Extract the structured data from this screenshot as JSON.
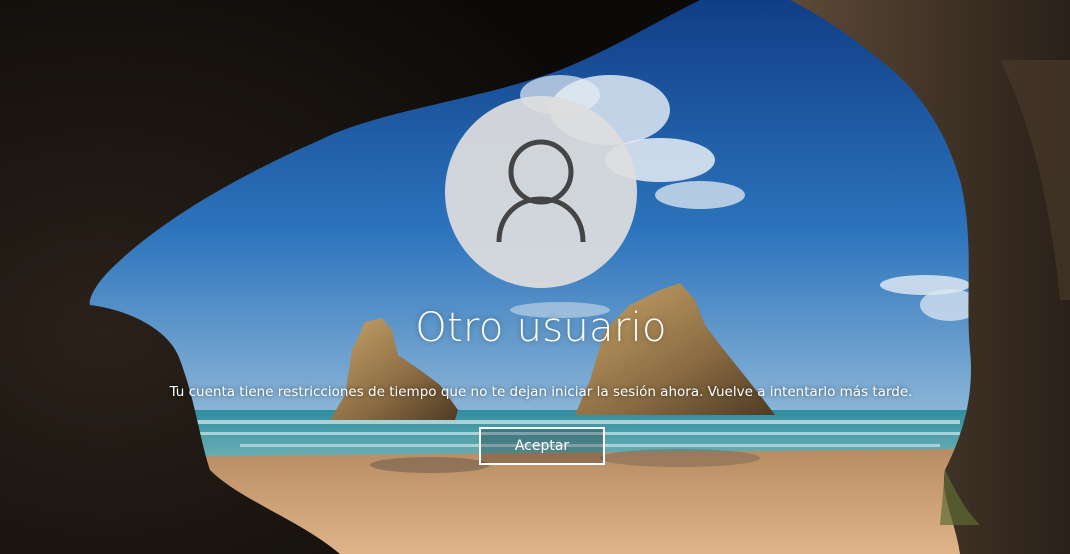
{
  "lockscreen": {
    "user_icon": "user-silhouette-icon",
    "username": "Otro usuario",
    "message": "Tu cuenta tiene restricciones de tiempo que no te dejan iniciar la sesión ahora. Vuelve a intentarlo más tarde.",
    "accept_label": "Aceptar"
  },
  "colors": {
    "sky": "#1f5fa6",
    "sea": "#2a8fa2",
    "sand": "#c89a6a",
    "cave": "#1a1512",
    "avatar_bg": "#dedede",
    "avatar_icon": "#444444",
    "text": "#ffffff"
  }
}
